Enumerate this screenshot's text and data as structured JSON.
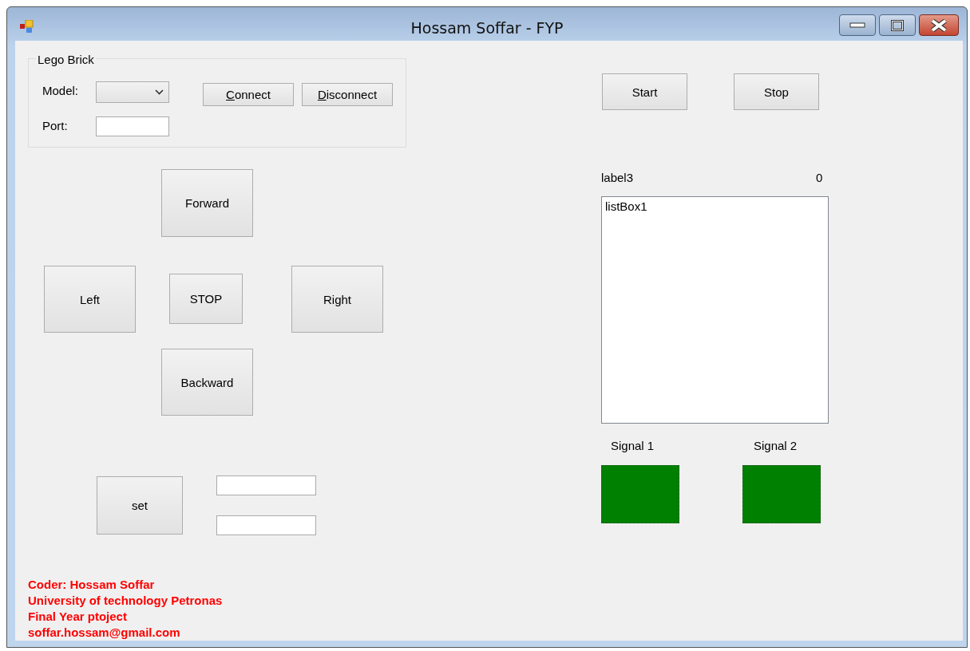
{
  "window": {
    "title": "Hossam Soffar - FYP"
  },
  "lego_brick": {
    "title": "Lego Brick",
    "model_label": "Model:",
    "port_label": "Port:",
    "buttons": [
      {
        "label": "Connect",
        "first_letter_underlined": true
      },
      {
        "label": "Disconnect",
        "first_letter_underlined": true
      }
    ]
  },
  "run_buttons": [
    {
      "label": "Start"
    },
    {
      "label": "Stop"
    }
  ],
  "drive_buttons": [
    {
      "label": "Forward"
    },
    {
      "label": "Left"
    },
    {
      "label": "STOP"
    },
    {
      "label": "Right"
    },
    {
      "label": "Backward"
    }
  ],
  "set_button": {
    "label": "set"
  },
  "status": {
    "label": "label3",
    "value": "0"
  },
  "list_box": {
    "items": [
      "listBox1"
    ]
  },
  "signals": [
    {
      "label": "Signal 1",
      "color": "#008000"
    },
    {
      "label": "Signal 2",
      "color": "#008000"
    }
  ],
  "credits": [
    "Coder: Hossam Soffar",
    "University of technology Petronas",
    "Final Year ptoject",
    "soffar.hossam@gmail.com"
  ]
}
